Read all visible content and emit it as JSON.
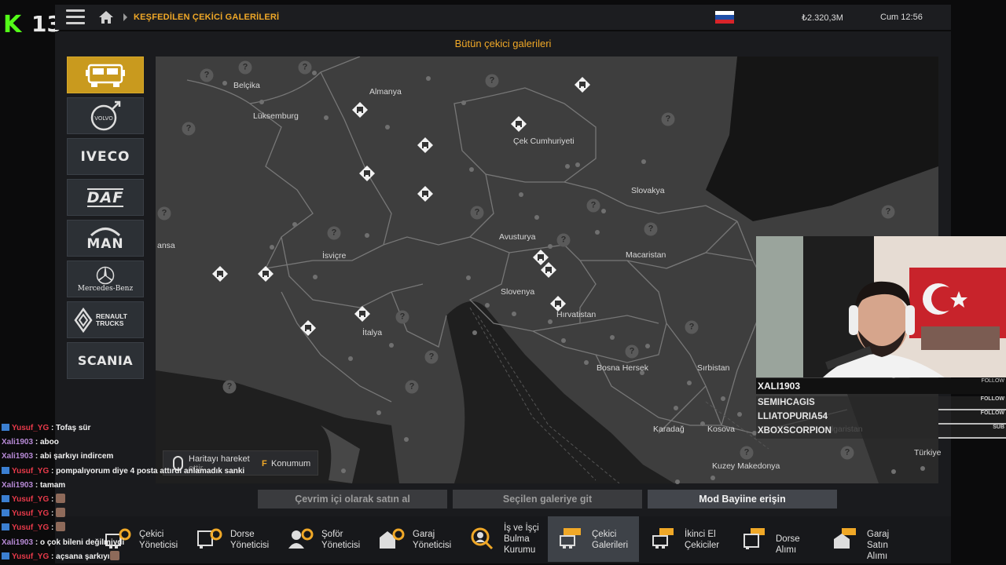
{
  "stream": {
    "logo_letter": "K",
    "logo_number": "13"
  },
  "topbar": {
    "breadcrumb": "KEŞFEDİLEN ÇEKİCİ GALERİLERİ",
    "money": "₺2.320,3M",
    "time": "Cum 12:56",
    "flag_colors": [
      "#ffffff",
      "#1f4fa8",
      "#d8242a"
    ]
  },
  "panel": {
    "title": "Bütün çekici galerileri"
  },
  "brands": [
    {
      "name": "all-trucks",
      "label": ""
    },
    {
      "name": "volvo",
      "label": "VOLVO"
    },
    {
      "name": "iveco",
      "label": "IVECO"
    },
    {
      "name": "daf",
      "label": "DAF"
    },
    {
      "name": "man",
      "label": "MAN"
    },
    {
      "name": "mercedes-benz",
      "label": "Mercedes-Benz"
    },
    {
      "name": "renault-trucks",
      "label": "RENAULT TRUCKS"
    },
    {
      "name": "scania",
      "label": "SCANIA"
    }
  ],
  "map": {
    "labels": {
      "belcika": "Belçika",
      "almanya": "Almanya",
      "luksemburg": "Lüksemburg",
      "cek": "Çek Cumhuriyeti",
      "slovakya": "Slovakya",
      "fransa": "ansa",
      "avusturya": "Avusturya",
      "macaristan": "Macaristan",
      "isvicre": "İsviçre",
      "slovenya": "Slovenya",
      "hirvatistan": "Hırvatistan",
      "italya": "İtalya",
      "bosna": "Bosna Hersek",
      "sirbistan": "Sırbistan",
      "karadag": "Karadağ",
      "kosova": "Kosova",
      "bulgaristan": "ulgaristan",
      "turkiye": "Türkiye",
      "makedonya": "Kuzey Makedonya"
    },
    "unknown_symbol": "?"
  },
  "hint": {
    "move": "Haritayı hareket",
    "move2": "ettir",
    "key": "F",
    "location": "Konumum"
  },
  "actions": {
    "buy_online": "Çevrim içi olarak satın al",
    "go_selected": "Seçilen galeriye git",
    "mod_dealer": "Mod Bayiine erişin"
  },
  "bottom": [
    {
      "name": "cekici-yoneticisi",
      "l1": "Çekici",
      "l2": "Yöneticisi",
      "l3": ""
    },
    {
      "name": "dorse-yoneticisi",
      "l1": "Dorse",
      "l2": "Yöneticisi",
      "l3": ""
    },
    {
      "name": "sofor-yoneticisi",
      "l1": "Şoför",
      "l2": "Yöneticisi",
      "l3": ""
    },
    {
      "name": "garaj-yoneticisi",
      "l1": "Garaj",
      "l2": "Yöneticisi",
      "l3": ""
    },
    {
      "name": "is-ve-isci",
      "l1": "İş ve İşçi",
      "l2": "Bulma",
      "l3": "Kurumu"
    },
    {
      "name": "cekici-galerileri",
      "l1": "Çekici",
      "l2": "Galerileri",
      "l3": ""
    },
    {
      "name": "ikinci-el",
      "l1": "İkinci El",
      "l2": "Çekiciler",
      "l3": ""
    },
    {
      "name": "dorse-alimi",
      "l1": "Dorse Alımı",
      "l2": "",
      "l3": ""
    },
    {
      "name": "garaj-satin-alimi",
      "l1": "Garaj Satın",
      "l2": "Alımı",
      "l3": ""
    }
  ],
  "webcam": {
    "streamer": "XALI1903",
    "follow_tag": "FOLLOW",
    "events": [
      {
        "name": "SEMIHCAGIS",
        "tag": "FOLLOW"
      },
      {
        "name": "LLIATOPURIA54",
        "tag": "FOLLOW"
      },
      {
        "name": "XBOXSCORPION",
        "tag": "SUB"
      }
    ]
  },
  "chat": [
    {
      "user": "Yusuf_YG",
      "color": "#e83a4a",
      "icon": true,
      "msg": "Tofaş sür"
    },
    {
      "user": "Xali1903",
      "color": "#b78ad6",
      "icon": false,
      "msg": "aboo"
    },
    {
      "user": "Xali1903",
      "color": "#b78ad6",
      "icon": false,
      "msg": "abi şarkıyı indircem"
    },
    {
      "user": "Yusuf_YG",
      "color": "#e83a4a",
      "icon": true,
      "msg": "pompalıyorum diye 4 posta attırdı anlamadık sanki"
    },
    {
      "user": "Xali1903",
      "color": "#b78ad6",
      "icon": false,
      "msg": "tamam"
    },
    {
      "user": "Yusuf_YG",
      "color": "#e83a4a",
      "icon": true,
      "msg": ""
    },
    {
      "user": "Yusuf_YG",
      "color": "#e83a4a",
      "icon": true,
      "msg": ""
    },
    {
      "user": "Yusuf_YG",
      "color": "#e83a4a",
      "icon": true,
      "msg": ""
    },
    {
      "user": "Xali1903",
      "color": "#b78ad6",
      "icon": false,
      "msg": "o çok bileni değilmiydi"
    },
    {
      "user": "Yusuf_YG",
      "color": "#e83a4a",
      "icon": true,
      "msg": "açsana şarkıyı"
    }
  ]
}
